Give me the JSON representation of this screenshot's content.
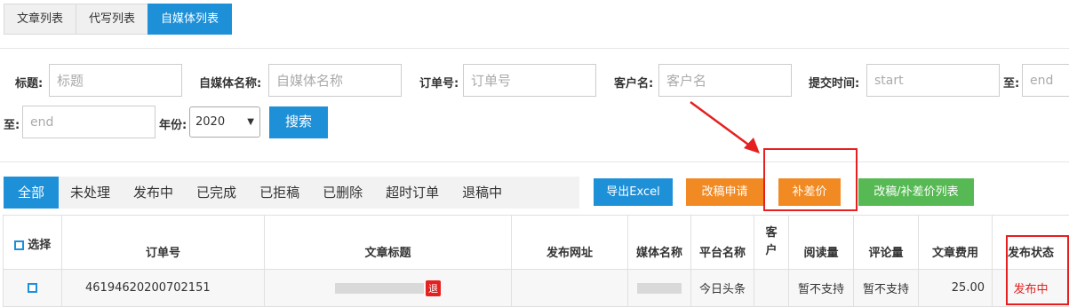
{
  "top_tabs": [
    {
      "label": "文章列表"
    },
    {
      "label": "代写列表"
    },
    {
      "label": "自媒体列表"
    }
  ],
  "filters": {
    "title": {
      "label": "标题:",
      "placeholder": "标题"
    },
    "media_name": {
      "label": "自媒体名称:",
      "placeholder": "自媒体名称"
    },
    "order_no": {
      "label": "订单号:",
      "placeholder": "订单号"
    },
    "customer": {
      "label": "客户名:",
      "placeholder": "客户名"
    },
    "submit_time": {
      "label": "提交时间:",
      "placeholder_start": "start",
      "to_label": "至:",
      "placeholder_end": "end"
    },
    "to2": {
      "label": "至:",
      "placeholder": "end"
    },
    "year": {
      "label": "年份:",
      "value": "2020"
    },
    "search_label": "搜索"
  },
  "status_tabs": [
    {
      "label": "全部"
    },
    {
      "label": "未处理"
    },
    {
      "label": "发布中"
    },
    {
      "label": "已完成"
    },
    {
      "label": "已拒稿"
    },
    {
      "label": "已删除"
    },
    {
      "label": "超时订单"
    },
    {
      "label": "退稿中"
    }
  ],
  "actions": {
    "export": "导出Excel",
    "revise": "改稿申请",
    "supplement": "补差价",
    "revise_list": "改稿/补差价列表"
  },
  "table": {
    "headers": {
      "select": "选择",
      "order_no": "订单号",
      "title": "文章标题",
      "url": "发布网址",
      "media": "媒体名称",
      "platform": "平台名称",
      "customer": "客户",
      "reads": "阅读量",
      "comments": "评论量",
      "fee": "文章费用",
      "status": "发布状态"
    },
    "rows": [
      {
        "order_no": "46194620200702151",
        "title_badge": "退",
        "url": "",
        "platform": "今日头条",
        "customer": "",
        "reads": "暂不支持",
        "comments": "暂不支持",
        "fee": "25.00",
        "status": "发布中"
      }
    ]
  },
  "colors": {
    "primary": "#1e90d8",
    "orange": "#f28a24",
    "green": "#57b954",
    "annotation_red": "#e52020"
  }
}
